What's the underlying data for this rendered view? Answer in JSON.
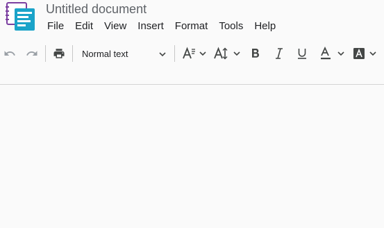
{
  "document": {
    "title": "Untitled document"
  },
  "menu": [
    "File",
    "Edit",
    "View",
    "Insert",
    "Format",
    "Tools",
    "Help"
  ],
  "toolbar": {
    "paragraph_style": "Normal text",
    "icons": [
      "undo-icon",
      "redo-icon",
      "print-icon",
      "font-size-icon",
      "line-height-icon",
      "bold-icon",
      "italic-icon",
      "underline-icon",
      "text-color-icon",
      "highlight-color-icon"
    ]
  },
  "colors": {
    "logo_purple": "#7b3fa0",
    "logo_teal": "#1aa3c9",
    "title_gray": "#5f6368",
    "icon_dark": "#444746",
    "icon_disabled": "#9aa0a6",
    "background": "#fafafa"
  }
}
